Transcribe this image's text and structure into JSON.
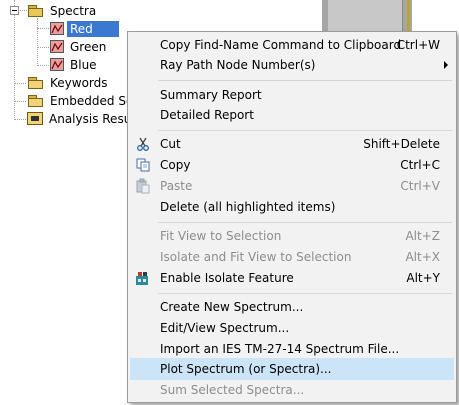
{
  "tree": {
    "items": [
      {
        "label": "Spectra"
      },
      {
        "label": "Red"
      },
      {
        "label": "Green"
      },
      {
        "label": "Blue"
      },
      {
        "label": "Keywords"
      },
      {
        "label": "Embedded Scripts"
      },
      {
        "label": "Analysis Results"
      }
    ]
  },
  "menu": {
    "items": [
      {
        "label": "Copy Find-Name Command to Clipboard",
        "shortcut": "Ctrl+W"
      },
      {
        "label": "Ray Path Node Number(s)",
        "shortcut": ""
      },
      {
        "label": "Summary Report",
        "shortcut": ""
      },
      {
        "label": "Detailed Report",
        "shortcut": ""
      },
      {
        "label": "Cut",
        "shortcut": "Shift+Delete",
        "icon": "scissors-icon"
      },
      {
        "label": "Copy",
        "shortcut": "Ctrl+C",
        "icon": "copy-icon"
      },
      {
        "label": "Paste",
        "shortcut": "Ctrl+V",
        "icon": "paste-icon"
      },
      {
        "label": "Delete (all highlighted items)",
        "shortcut": ""
      },
      {
        "label": "Fit View to Selection",
        "shortcut": "Alt+Z"
      },
      {
        "label": "Isolate and Fit View to Selection",
        "shortcut": "Alt+X"
      },
      {
        "label": "Enable Isolate Feature",
        "shortcut": "Alt+Y",
        "icon": "isolate-icon"
      },
      {
        "label": "Create New Spectrum...",
        "shortcut": ""
      },
      {
        "label": "Edit/View Spectrum...",
        "shortcut": ""
      },
      {
        "label": "Import an IES TM-27-14 Spectrum File...",
        "shortcut": ""
      },
      {
        "label": "Plot Spectrum (or Spectra)...",
        "shortcut": ""
      },
      {
        "label": "Sum Selected Spectra...",
        "shortcut": ""
      }
    ]
  },
  "colors": {
    "selection": "#3a78d2",
    "menu_hover": "#cce4f7",
    "menu_background": "#f2f2f2",
    "disabled_text": "#8d8d8d"
  }
}
